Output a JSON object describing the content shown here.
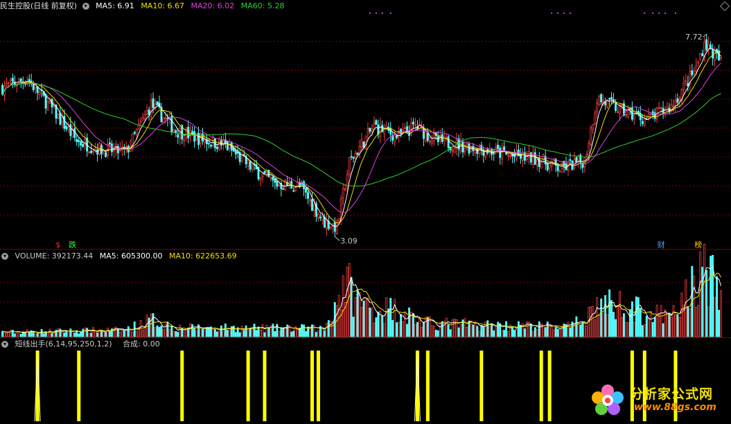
{
  "title": "民生控股(日线 前复权)",
  "price_header": {
    "ma5": {
      "label": "MA5: 6.91",
      "color": "#ffffff"
    },
    "ma10": {
      "label": "MA10: 6.67",
      "color": "#f0e000"
    },
    "ma20": {
      "label": "MA20: 6.02",
      "color": "#e040e0"
    },
    "ma60": {
      "label": "MA60: 5.28",
      "color": "#30d030"
    }
  },
  "volume_header": {
    "volume": {
      "label": "VOLUME: 392173.44",
      "color": "#cccccc"
    },
    "ma5": {
      "label": "MA5: 605300.00",
      "color": "#ffffff"
    },
    "ma10": {
      "label": "MA10: 622653.69",
      "color": "#f0e000"
    }
  },
  "signal_header": {
    "name": {
      "label": "短线出手(6,14,95,250,1,2)",
      "color": "#cccccc"
    },
    "value": {
      "label": "合成: 0.00",
      "color": "#cccccc"
    }
  },
  "annotations": {
    "high": "7.72",
    "low": "3.09",
    "markers": [
      {
        "text": "$",
        "color": "#ff3030",
        "at": 27
      },
      {
        "text": "跌",
        "color": "#30ff30",
        "at": 34
      },
      {
        "text": "财",
        "color": "#4ca0ff",
        "at": 319
      },
      {
        "text": "榜",
        "color": "#ffcc00",
        "at": 337
      }
    ]
  },
  "watermark": {
    "cn": "分析家公式网",
    "url": "www.88gs.com"
  },
  "colors": {
    "up": "#ff4040",
    "down": "#54ffff",
    "grid": "#7a0000",
    "divider": "#8a0000",
    "ma5": "#ffffff",
    "ma10": "#f0e000",
    "ma20": "#e040e0",
    "ma60": "#30d030",
    "signal": "#ffff00"
  },
  "chart_data": {
    "type": "candlestick",
    "bars": 349,
    "price_ylim": [
      2.8,
      8.2
    ],
    "volume_ylim": [
      0,
      1650000
    ],
    "price_anchors": [
      [
        0,
        6.45
      ],
      [
        12,
        6.65
      ],
      [
        24,
        5.95
      ],
      [
        36,
        5.2
      ],
      [
        48,
        5.0
      ],
      [
        60,
        4.95
      ],
      [
        72,
        6.05
      ],
      [
        84,
        5.45
      ],
      [
        96,
        5.25
      ],
      [
        108,
        5.1
      ],
      [
        120,
        4.6
      ],
      [
        132,
        4.2
      ],
      [
        144,
        4.15
      ],
      [
        156,
        3.3
      ],
      [
        162,
        3.2
      ],
      [
        168,
        4.7
      ],
      [
        180,
        5.55
      ],
      [
        192,
        5.3
      ],
      [
        200,
        5.55
      ],
      [
        210,
        5.2
      ],
      [
        222,
        5.1
      ],
      [
        234,
        5.0
      ],
      [
        246,
        4.85
      ],
      [
        258,
        4.8
      ],
      [
        270,
        4.55
      ],
      [
        282,
        4.75
      ],
      [
        288,
        6.2
      ],
      [
        300,
        5.9
      ],
      [
        312,
        5.7
      ],
      [
        324,
        6.0
      ],
      [
        336,
        6.9
      ],
      [
        340,
        7.5
      ],
      [
        344,
        7.25
      ],
      [
        348,
        7.05
      ]
    ],
    "volume_anchors": [
      [
        0,
        100000
      ],
      [
        60,
        150000
      ],
      [
        72,
        380000
      ],
      [
        84,
        200000
      ],
      [
        156,
        180000
      ],
      [
        166,
        1250000
      ],
      [
        172,
        820000
      ],
      [
        180,
        620000
      ],
      [
        192,
        620000
      ],
      [
        204,
        300000
      ],
      [
        240,
        250000
      ],
      [
        276,
        220000
      ],
      [
        288,
        700000
      ],
      [
        300,
        720000
      ],
      [
        312,
        520000
      ],
      [
        324,
        420000
      ],
      [
        336,
        1250000
      ],
      [
        340,
        1520000
      ],
      [
        348,
        900000
      ]
    ],
    "signal_bars": [
      17,
      37,
      87,
      119,
      127,
      150,
      153,
      201,
      206,
      232,
      261,
      265,
      305,
      311,
      326
    ]
  }
}
